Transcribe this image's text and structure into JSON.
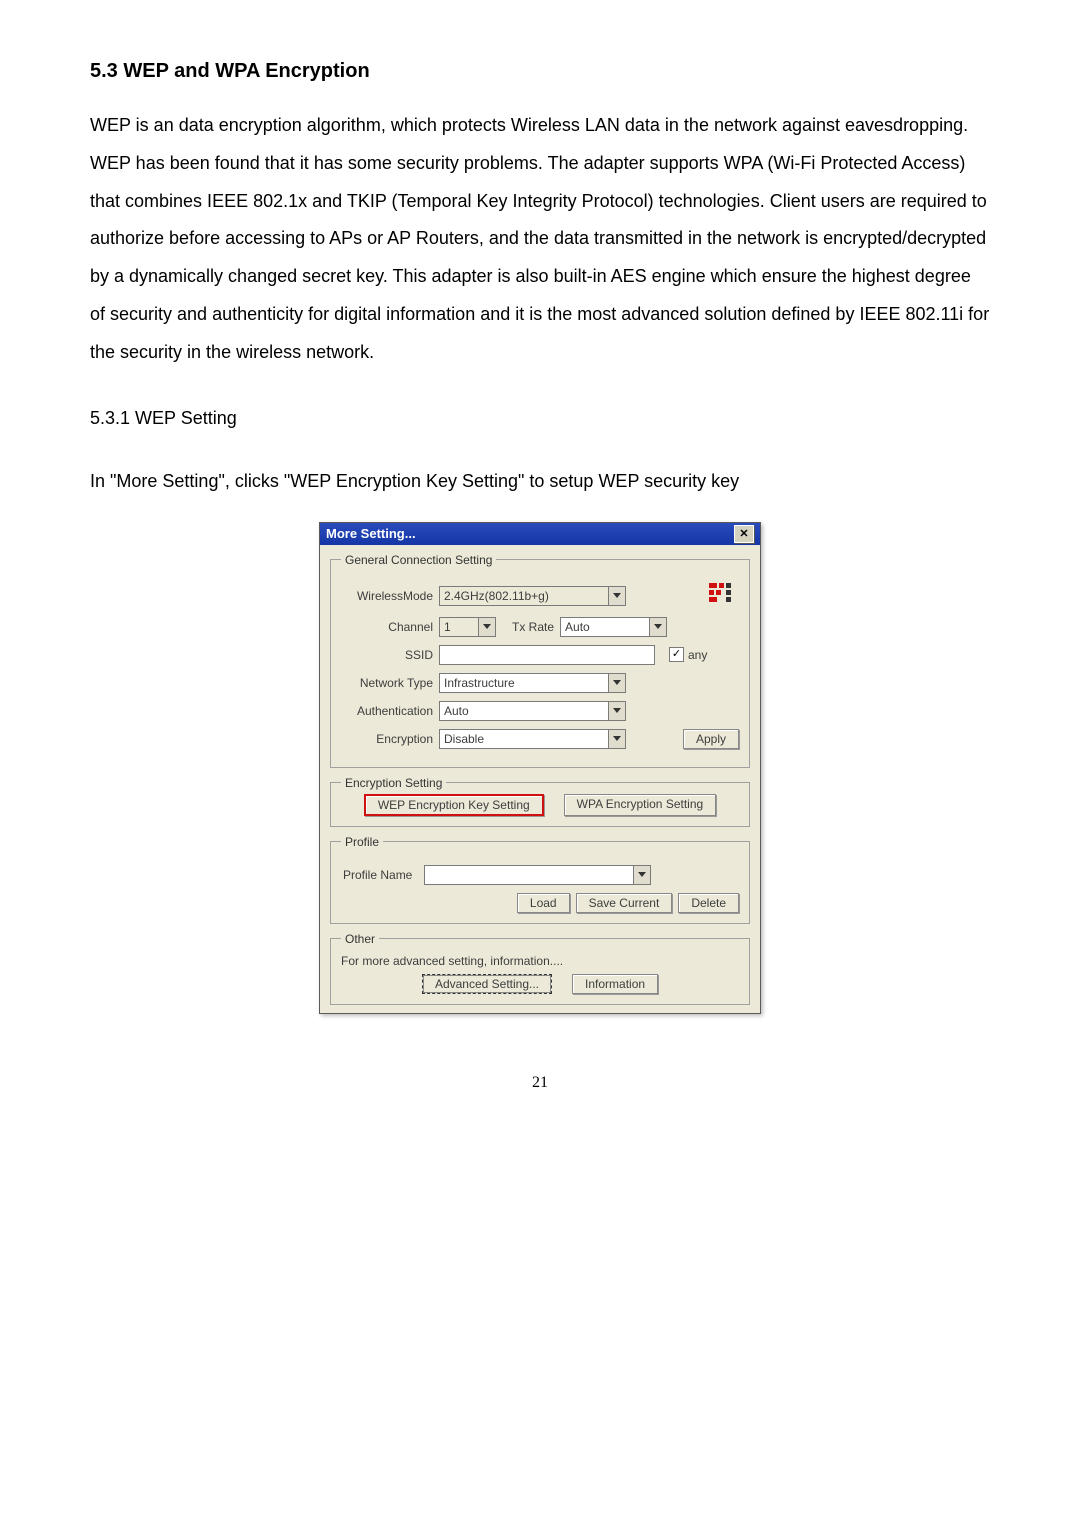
{
  "section_heading": "5.3  WEP and WPA Encryption",
  "paragraph": "WEP is an data encryption algorithm, which protects Wireless LAN data in the network against eavesdropping. WEP has been found that it has some security problems. The adapter supports WPA (Wi-Fi Protected Access) that combines IEEE 802.1x and TKIP (Temporal Key Integrity Protocol) technologies. Client users are required to authorize before accessing to APs or AP Routers, and the data transmitted in the network is encrypted/decrypted by a dynamically changed secret key. This adapter is also built-in AES engine which ensure the highest degree of security and authenticity for digital information and it is the most advanced solution defined by IEEE 802.11i for the security in the wireless network.",
  "subsection_heading": "5.3.1  WEP Setting",
  "instruction": "In \"More Setting\", clicks \"WEP Encryption Key Setting\" to setup WEP security key",
  "dialog": {
    "title": "More Setting...",
    "groups": {
      "general": {
        "legend": "General Connection Setting",
        "wireless_mode": {
          "label": "WirelessMode",
          "value": "2.4GHz(802.11b+g)"
        },
        "channel": {
          "label": "Channel",
          "value": "1"
        },
        "txrate": {
          "label": "Tx Rate",
          "value": "Auto"
        },
        "ssid": {
          "label": "SSID",
          "value": ""
        },
        "any_checkbox": "any",
        "network_type": {
          "label": "Network Type",
          "value": "Infrastructure"
        },
        "authentication": {
          "label": "Authentication",
          "value": "Auto"
        },
        "encryption": {
          "label": "Encryption",
          "value": "Disable"
        },
        "apply_btn": "Apply"
      },
      "encryption_setting": {
        "legend": "Encryption Setting",
        "wep_btn": "WEP Encryption Key Setting",
        "wpa_btn": "WPA Encryption Setting"
      },
      "profile": {
        "legend": "Profile",
        "name_label": "Profile Name",
        "name_value": "",
        "load_btn": "Load",
        "save_btn": "Save Current",
        "delete_btn": "Delete"
      },
      "other": {
        "legend": "Other",
        "text": "For more advanced setting, information....",
        "advanced_btn": "Advanced Setting...",
        "info_btn": "Information"
      }
    }
  },
  "page_number": "21"
}
